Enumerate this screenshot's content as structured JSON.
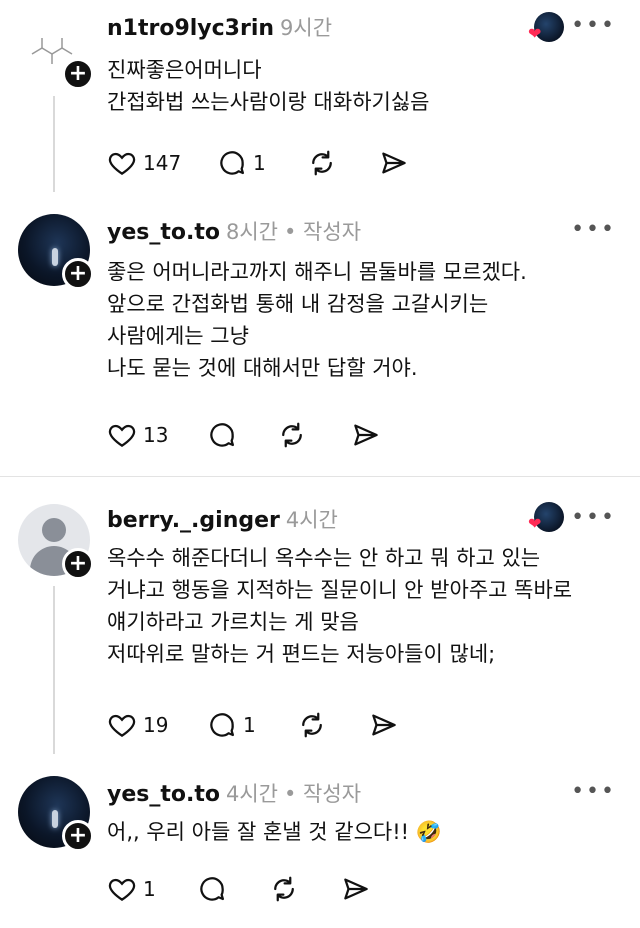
{
  "posts": [
    {
      "username": "n1tro9lyc3rin",
      "time": "9시간",
      "author_tag": "",
      "text": "진짜좋은어머니다\n간접화법 쓰는사람이랑 대화하기싫음",
      "likes": "147",
      "comments": "1",
      "avatar": "molecule"
    },
    {
      "username": "yes_to.to",
      "time": "8시간",
      "author_tag": "• 작성자",
      "text": "좋은 어머니라고까지 해주니 몸둘바를 모르겠다.\n앞으로 간접화법 통해 내 감정을 고갈시키는\n사람에게는 그냥\n나도 묻는 것에 대해서만 답할 거야.",
      "likes": "13",
      "comments": "",
      "avatar": "night"
    },
    {
      "username": "berry._.ginger",
      "time": "4시간",
      "author_tag": "",
      "text": "옥수수 해준다더니 옥수수는 안 하고 뭐 하고 있는\n거냐고 행동을 지적하는 질문이니 안 받아주고 똑바로\n얘기하라고 가르치는 게 맞음\n저따위로 말하는 거 편드는 저능아들이 많네;",
      "likes": "19",
      "comments": "1",
      "avatar": "default"
    },
    {
      "username": "yes_to.to",
      "time": "4시간",
      "author_tag": "• 작성자",
      "text": "어,, 우리 아들 잘 혼낼 것 같으다!! 🤣",
      "likes": "1",
      "comments": "",
      "avatar": "night"
    }
  ],
  "icons": {
    "more": "more-icon",
    "like": "heart-icon",
    "comment": "comment-icon",
    "repost": "repost-icon",
    "share": "share-icon"
  },
  "more_label": "•••"
}
